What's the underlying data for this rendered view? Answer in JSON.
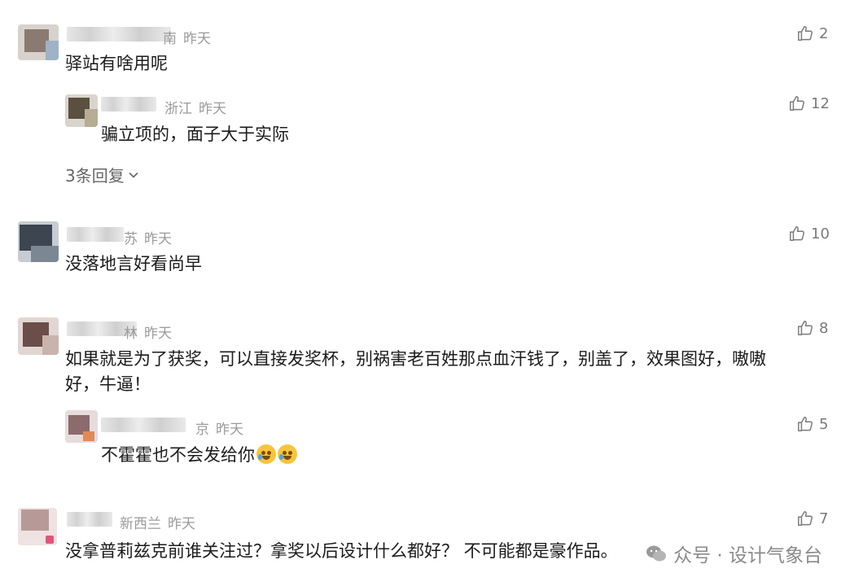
{
  "comments": [
    {
      "id": "c1",
      "meta_suffix": "南",
      "time": "昨天",
      "text": "驿站有啥用呢",
      "likes": "2",
      "replies": [
        {
          "location": "浙江",
          "time": "昨天",
          "text": "骗立项的，面子大于实际",
          "likes": "12"
        }
      ],
      "more_replies": "3条回复"
    },
    {
      "id": "c2",
      "meta_suffix": "苏",
      "time": "昨天",
      "text": "没落地言好看尚早",
      "likes": "10"
    },
    {
      "id": "c3",
      "meta_suffix": "林",
      "time": "昨天",
      "text_line1": "如果就是为了获奖，可以直接发奖杯，别祸害老百姓那点血汗钱了，别盖了，效果图好，嗷嗷",
      "text_line2": "好，牛逼！",
      "likes": "8",
      "replies": [
        {
          "location": "京",
          "time": "昨天",
          "text": "不霍霍也不会发给你",
          "likes": "5",
          "emojis": [
            "crying-laughing-emoji",
            "crying-laughing-emoji"
          ]
        }
      ]
    },
    {
      "id": "c4",
      "location": "新西兰",
      "time": "昨天",
      "text": "没拿普莉兹克前谁关注过？拿奖以后设计什么都好？ 不可能都是豪作品。",
      "likes": "7"
    }
  ],
  "watermark": {
    "text": "众号 · 设计气象台",
    "icon": "wechat-logo-icon"
  },
  "colors": {
    "meta_text": "#9a9a9a",
    "body_text": "#1b1b1b",
    "like_icon": "#7a7a7a",
    "background": "#ffffff"
  }
}
